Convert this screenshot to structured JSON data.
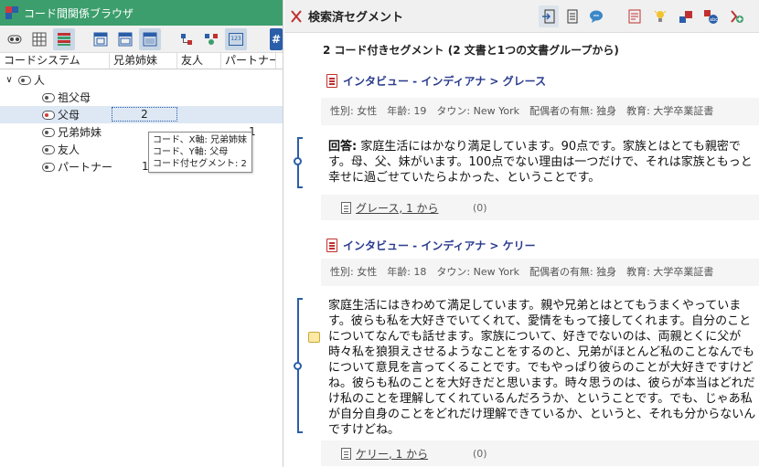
{
  "left_panel": {
    "title": "コード間関係ブラウザ",
    "columns": [
      "コードシステム",
      "兄弟姉妹",
      "友人",
      "パートナー"
    ],
    "root": "人",
    "rows": [
      {
        "label": "祖父母",
        "value": "",
        "value_col": ""
      },
      {
        "label": "父母",
        "value": "2",
        "value_col": "兄弟姉妹"
      },
      {
        "label": "兄弟姉妹",
        "value": "1",
        "value_col": "パートナー"
      },
      {
        "label": "友人",
        "value": "",
        "value_col": ""
      },
      {
        "label": "パートナー",
        "value": "1",
        "value_col": "兄弟姉妹"
      }
    ],
    "tooltip": [
      "コード、X軸: 兄弟姉妹",
      "コード、Y軸: 父母",
      "コード付セグメント: 2"
    ],
    "tool_badge": "123",
    "tool_hash": "#"
  },
  "right_panel": {
    "title": "検索済セグメント",
    "summary": "2 コード付きセグメント (2 文書と1つの文書グループから)",
    "documents": [
      {
        "path": "インタビュー - インディアナ > グレース",
        "meta": "性別: 女性　年齢: 19　タウン: New York　配偶者の有無: 独身　教育: 大学卒業証書",
        "segment_prefix": "回答:",
        "segment_text": " 家庭生活にはかなり満足しています。90点です。家族とはとても親密です。母、父、妹がいます。100点でない理由は一つだけで、それは家族ともっと幸せに過ごせていたらよかった、ということです。",
        "source": "グレース, 1 から",
        "count": "(0)"
      },
      {
        "path": "インタビュー - インディアナ > ケリー",
        "meta": "性別: 女性　年齢: 18　タウン: New York　配偶者の有無: 独身　教育: 大学卒業証書",
        "segment_prefix": "",
        "segment_text": "家庭生活にはきわめて満足しています。親や兄弟とはとてもうまくやっています。彼らも私を大好きでいてくれて、愛情をもって接してくれます。自分のことについてなんでも話せます。家族について、好きでないのは、両親とくに父が時々私を狼狽えさせるようなことをするのと、兄弟がほとんど私のことなんでもについて意見を言ってくることです。でもやっぱり彼らのことが大好きですけどね。彼らも私のことを大好きだと思います。時々思うのは、彼らが本当はどれだけ私のことを理解してくれているんだろうか、ということです。でも、じゃあ私が自分自身のことをどれだけ理解できているか、というと、それも分からないんですけどね。",
        "source": "ケリー, 1 から",
        "count": "(0)"
      }
    ],
    "colors": {
      "accent": "#2a5ea8",
      "header_green": "#3c9e6c",
      "doc_red": "#c03030",
      "link_blue": "#2a3b8f"
    }
  }
}
